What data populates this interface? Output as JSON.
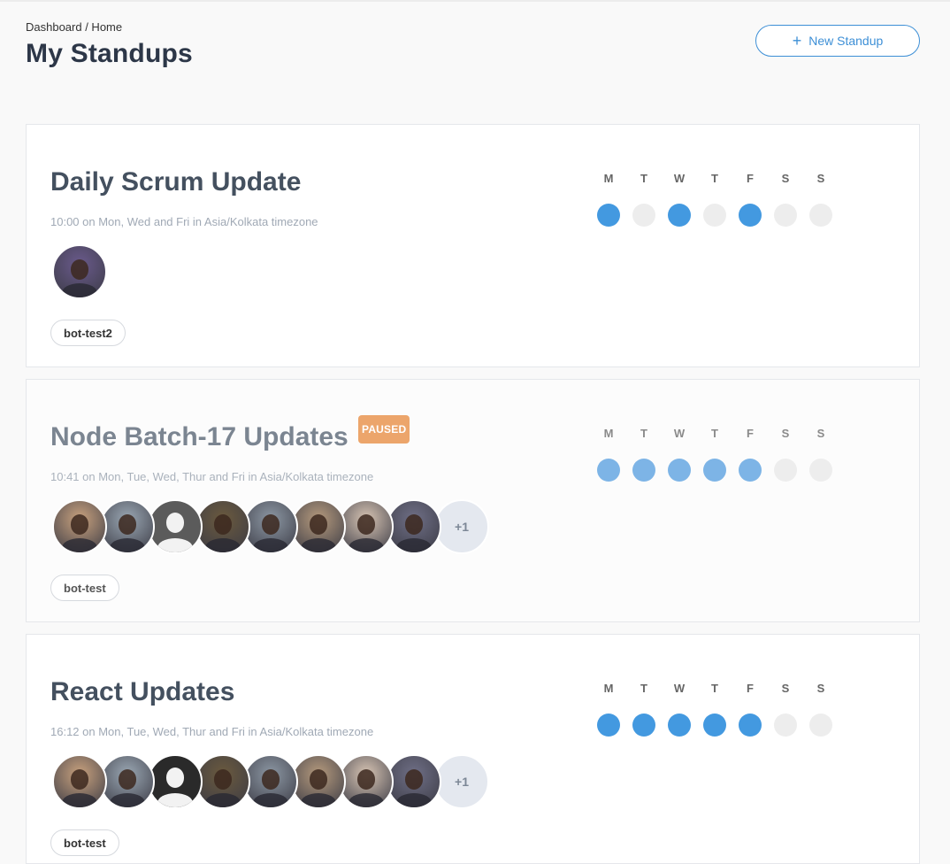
{
  "header": {
    "breadcrumb": "Dashboard / Home",
    "title": "My Standups",
    "new_button_label": "New Standup",
    "new_button_icon": "plus-icon"
  },
  "days": [
    "M",
    "T",
    "W",
    "T",
    "F",
    "S",
    "S"
  ],
  "colors": {
    "accent": "#4399e0",
    "paused_badge": "#eca56b",
    "inactive_dot": "#ededed"
  },
  "standups": [
    {
      "title": "Daily Scrum Update",
      "schedule": "10:00 on Mon, Wed and Fri in Asia/Kolkata timezone",
      "paused": false,
      "badge": "",
      "channel": "bot-test2",
      "active_days": [
        true,
        false,
        true,
        false,
        true,
        false,
        false
      ],
      "avatars": [
        "user-photo"
      ],
      "more_count": ""
    },
    {
      "title": "Node Batch-17 Updates",
      "schedule": "10:41 on Mon, Tue, Wed, Thur and Fri in Asia/Kolkata timezone",
      "paused": true,
      "badge": "PAUSED",
      "channel": "bot-test",
      "active_days": [
        true,
        true,
        true,
        true,
        true,
        false,
        false
      ],
      "avatars": [
        "user-photo",
        "user-photo",
        "default-avatar",
        "user-photo",
        "user-photo",
        "user-photo",
        "user-photo",
        "user-photo"
      ],
      "more_count": "+1"
    },
    {
      "title": "React Updates",
      "schedule": "16:12 on Mon, Tue, Wed, Thur and Fri in Asia/Kolkata timezone",
      "paused": false,
      "badge": "",
      "channel": "bot-test",
      "active_days": [
        true,
        true,
        true,
        true,
        true,
        false,
        false
      ],
      "avatars": [
        "user-photo",
        "user-photo",
        "default-avatar",
        "user-photo",
        "user-photo",
        "user-photo",
        "user-photo",
        "user-photo"
      ],
      "more_count": "+1"
    }
  ]
}
